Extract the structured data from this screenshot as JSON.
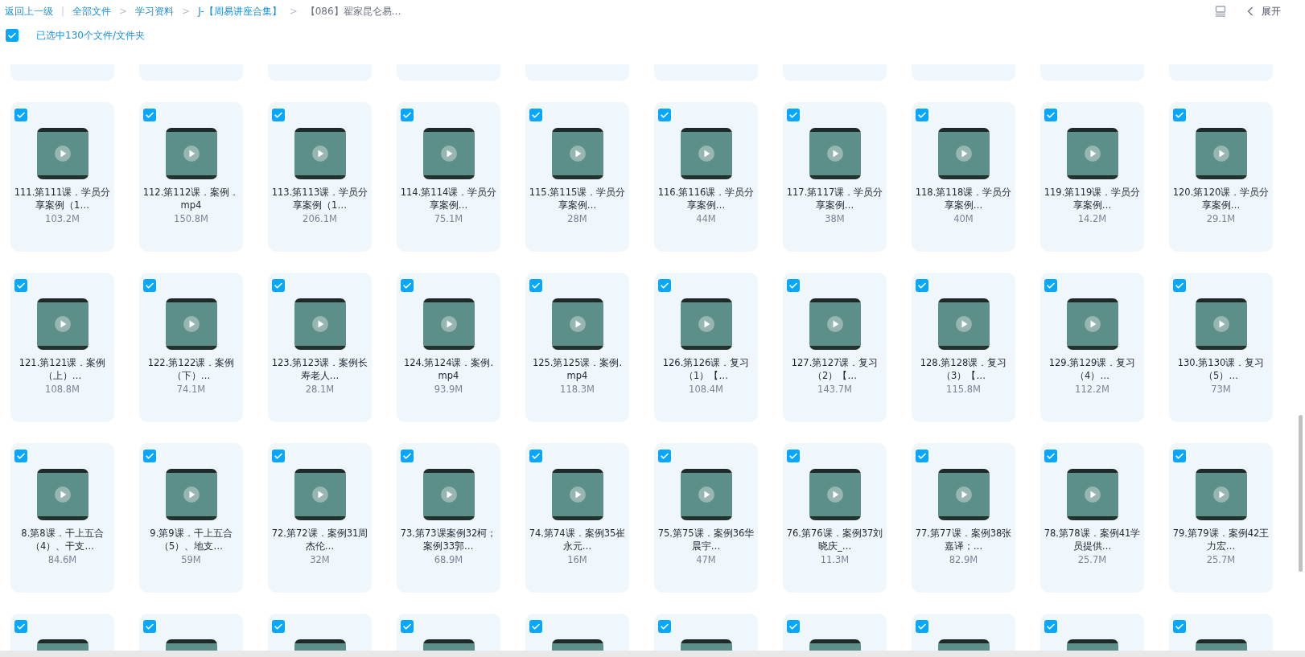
{
  "breadcrumb": {
    "back": "返回上一级",
    "separator": "|",
    "items": [
      {
        "label": "全部文件",
        "current": false
      },
      {
        "label": "学习资料",
        "current": false
      },
      {
        "label": "J-【周易讲座合集】",
        "current": false
      },
      {
        "label": "【086】翟家昆仑易…",
        "current": true
      }
    ],
    "arrow": ">"
  },
  "toolbar": {
    "expand_label": "展开"
  },
  "selection": {
    "checked": true,
    "label": "已选中130个文件/文件夹"
  },
  "files": [
    {
      "name": "111.第111课．学员分享案例（1…",
      "size": "103.2M",
      "selected": true
    },
    {
      "name": "112.第112课．案例．mp4",
      "size": "150.8M",
      "selected": true
    },
    {
      "name": "113.第113课．学员分享案例（1…",
      "size": "206.1M",
      "selected": true
    },
    {
      "name": "114.第114课．学员分享案例…",
      "size": "75.1M",
      "selected": true
    },
    {
      "name": "115.第115课．学员分享案例…",
      "size": "28M",
      "selected": true
    },
    {
      "name": "116.第116课．学员分享案例…",
      "size": "44M",
      "selected": true
    },
    {
      "name": "117.第117课．学员分享案例…",
      "size": "38M",
      "selected": true
    },
    {
      "name": "118.第118课．学员分享案例…",
      "size": "40M",
      "selected": true
    },
    {
      "name": "119.第119课．学员分享案例…",
      "size": "14.2M",
      "selected": true
    },
    {
      "name": "120.第120课．学员分享案例…",
      "size": "29.1M",
      "selected": true
    },
    {
      "name": "121.第121课．案例（上）…",
      "size": "108.8M",
      "selected": true
    },
    {
      "name": "122.第122课．案例（下）…",
      "size": "74.1M",
      "selected": true
    },
    {
      "name": "123.第123课．案例长寿老人…",
      "size": "28.1M",
      "selected": true
    },
    {
      "name": "124.第124课．案例.mp4",
      "size": "93.9M",
      "selected": true
    },
    {
      "name": "125.第125课．案例.mp4",
      "size": "118.3M",
      "selected": true
    },
    {
      "name": "126.第126课．复习（1）【…",
      "size": "108.4M",
      "selected": true
    },
    {
      "name": "127.第127课．复习（2）【…",
      "size": "143.7M",
      "selected": true
    },
    {
      "name": "128.第128课．复习（3）【…",
      "size": "115.8M",
      "selected": true
    },
    {
      "name": "129.第129课．复习（4）…",
      "size": "112.2M",
      "selected": true
    },
    {
      "name": "130.第130课．复习（5）…",
      "size": "73M",
      "selected": true
    },
    {
      "name": "8.第8课．干上五合（4）、干支…",
      "size": "84.6M",
      "selected": true
    },
    {
      "name": "9.第9课．干上五合（5）、地支…",
      "size": "59M",
      "selected": true
    },
    {
      "name": "72.第72课．案例31周杰伦…",
      "size": "32M",
      "selected": true
    },
    {
      "name": "73.第73课案例32柯；案例33郭…",
      "size": "68.9M",
      "selected": true
    },
    {
      "name": "74.第74课．案例35崔永元…",
      "size": "16M",
      "selected": true
    },
    {
      "name": "75.第75课．案例36华晨宇…",
      "size": "47M",
      "selected": true
    },
    {
      "name": "76.第76课．案例37刘晓庆_…",
      "size": "11.3M",
      "selected": true
    },
    {
      "name": "77.第77课．案例38张嘉译；…",
      "size": "82.9M",
      "selected": true
    },
    {
      "name": "78.第78课．案例41学员提供…",
      "size": "25.7M",
      "selected": true
    },
    {
      "name": "79.第79课．案例42王力宏…",
      "size": "25.7M",
      "selected": true
    }
  ],
  "partial_files": [
    {
      "selected": true
    },
    {
      "selected": true
    },
    {
      "selected": true
    },
    {
      "selected": true
    },
    {
      "selected": true
    },
    {
      "selected": true
    },
    {
      "selected": true
    },
    {
      "selected": true
    },
    {
      "selected": true
    },
    {
      "selected": true
    }
  ]
}
